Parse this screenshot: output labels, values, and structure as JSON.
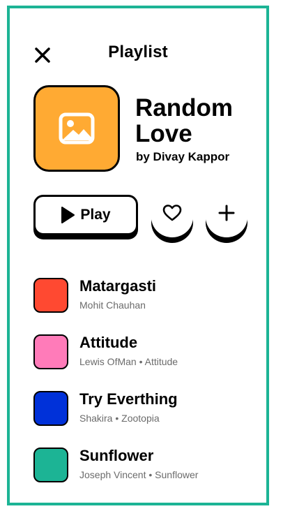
{
  "header": {
    "title": "Playlist",
    "close_icon": "close-icon"
  },
  "playlist": {
    "title": "Random Love",
    "author": "by Divay Kappor",
    "cover_color": "#FFAA33",
    "cover_icon": "image-icon"
  },
  "actions": {
    "play_label": "Play",
    "play_icon": "play-icon",
    "like_icon": "heart-icon",
    "add_icon": "plus-icon"
  },
  "tracks": [
    {
      "name": "Matargasti",
      "meta": "Mohit Chauhan",
      "color": "#FF4931"
    },
    {
      "name": "Attitude",
      "meta": "Lewis OfMan • Attitude",
      "color": "#FF7BB9"
    },
    {
      "name": "Try Everthing",
      "meta": "Shakira • Zootopia",
      "color": "#0031D9"
    },
    {
      "name": "Sunflower",
      "meta": "Joseph Vincent • Sunflower",
      "color": "#1CB495"
    }
  ],
  "theme": {
    "frame_border": "#1CB495"
  }
}
